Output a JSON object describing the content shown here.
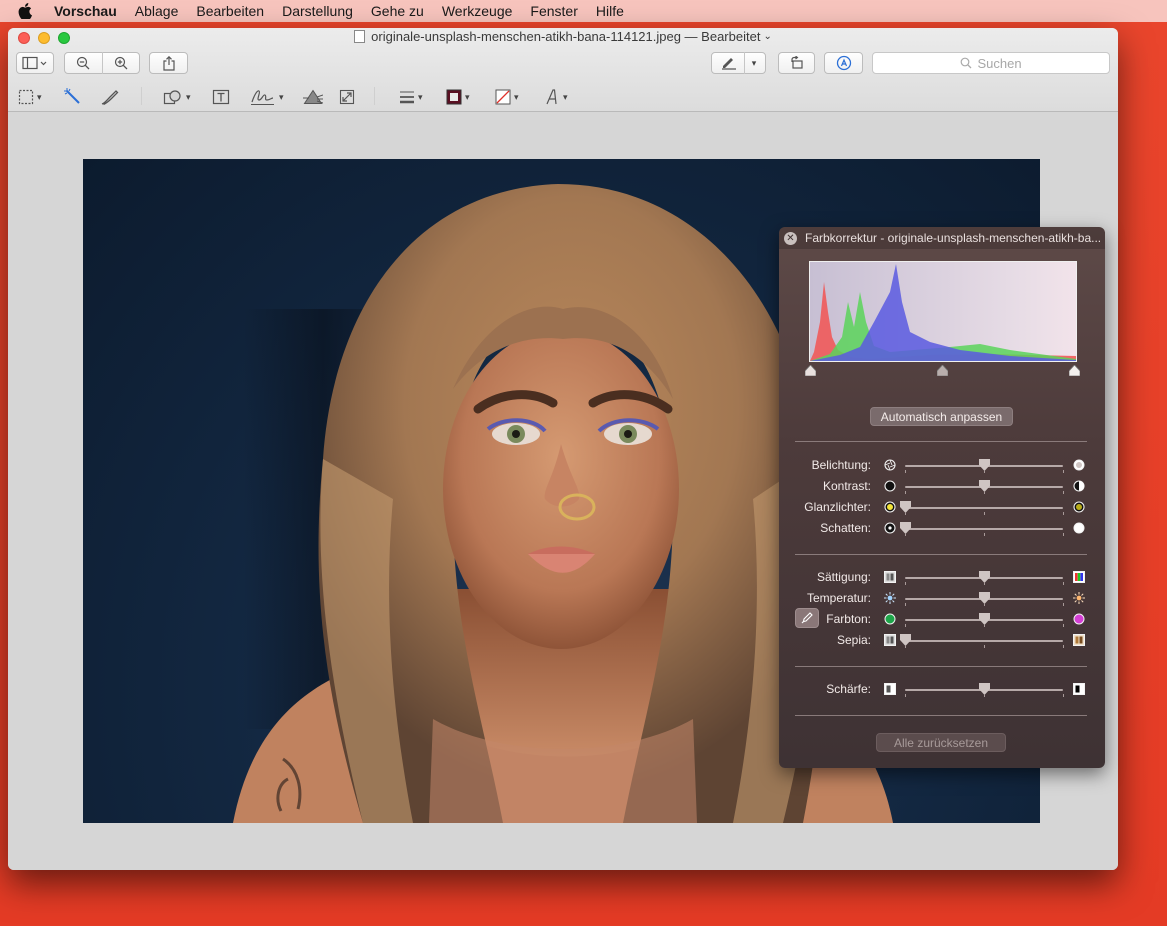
{
  "menubar": {
    "app": "Vorschau",
    "items": [
      "Ablage",
      "Bearbeiten",
      "Darstellung",
      "Gehe zu",
      "Werkzeuge",
      "Fenster",
      "Hilfe"
    ]
  },
  "window": {
    "title": "originale-unsplash-menschen-atikh-bana-114121.jpeg — Bearbeitet",
    "search_placeholder": "Suchen"
  },
  "panel": {
    "title": "Farbkorrektur - originale-unsplash-menschen-atikh-ba...",
    "auto_label": "Automatisch anpassen",
    "reset_label": "Alle zurücksetzen",
    "sliders": [
      {
        "label": "Belichtung:",
        "value": 0.5
      },
      {
        "label": "Kontrast:",
        "value": 0.5
      },
      {
        "label": "Glanzlichter:",
        "value": 0.0
      },
      {
        "label": "Schatten:",
        "value": 0.0
      },
      {
        "label": "Sättigung:",
        "value": 0.5
      },
      {
        "label": "Temperatur:",
        "value": 0.5
      },
      {
        "label": "Farbton:",
        "value": 0.5
      },
      {
        "label": "Sepia:",
        "value": 0.0
      },
      {
        "label": "Schärfe:",
        "value": 0.5
      }
    ],
    "histogram_levels": {
      "black": 0.0,
      "mid": 0.5,
      "white": 1.0
    }
  },
  "colors": {
    "desktop": "#e5432b",
    "menubar": "#f7c4bd",
    "hist_red": "#f05a5a",
    "hist_green": "#5ad45a",
    "hist_blue": "#5a5ae0"
  }
}
